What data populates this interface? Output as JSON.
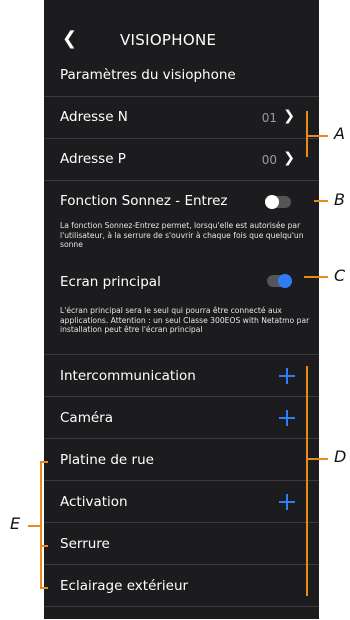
{
  "header": {
    "back_icon": "chevron-left-icon",
    "title": "VISIOPHONE"
  },
  "section_title": "Paramètres du visiophone",
  "address_rows": [
    {
      "label": "Adresse N",
      "value": "01"
    },
    {
      "label": "Adresse P",
      "value": "00"
    }
  ],
  "sonnez_entrez": {
    "label": "Fonction Sonnez - Entrez",
    "state": "off",
    "description": "La fonction Sonnez-Entrez permet, lorsqu'elle est autorisée par l'utilisateur, à la serrure de s'ouvrir à chaque fois que quelqu'un sonne"
  },
  "ecran_principal": {
    "label": "Ecran principal",
    "state": "on",
    "description": "L'écran principal sera le seul qui pourra être connecté aux applications. Attention : un seul Classe 300EOS with Netatmo par installation peut être l'écran principal"
  },
  "function_rows": [
    {
      "label": "Intercommunication",
      "action": "plus-icon"
    },
    {
      "label": "Caméra",
      "action": "plus-icon"
    },
    {
      "label": "Platine de rue"
    },
    {
      "label": "Activation",
      "action": "plus-icon"
    },
    {
      "label": "Serrure"
    },
    {
      "label": "Eclairage extérieur"
    }
  ],
  "annotations": {
    "A": "A",
    "B": "B",
    "C": "C",
    "D": "D",
    "E": "E"
  },
  "colors": {
    "background": "#1c1c1e",
    "accent": "#2f7cf6",
    "annotation": "#e88a1e",
    "divider": "#3a3a3c"
  }
}
